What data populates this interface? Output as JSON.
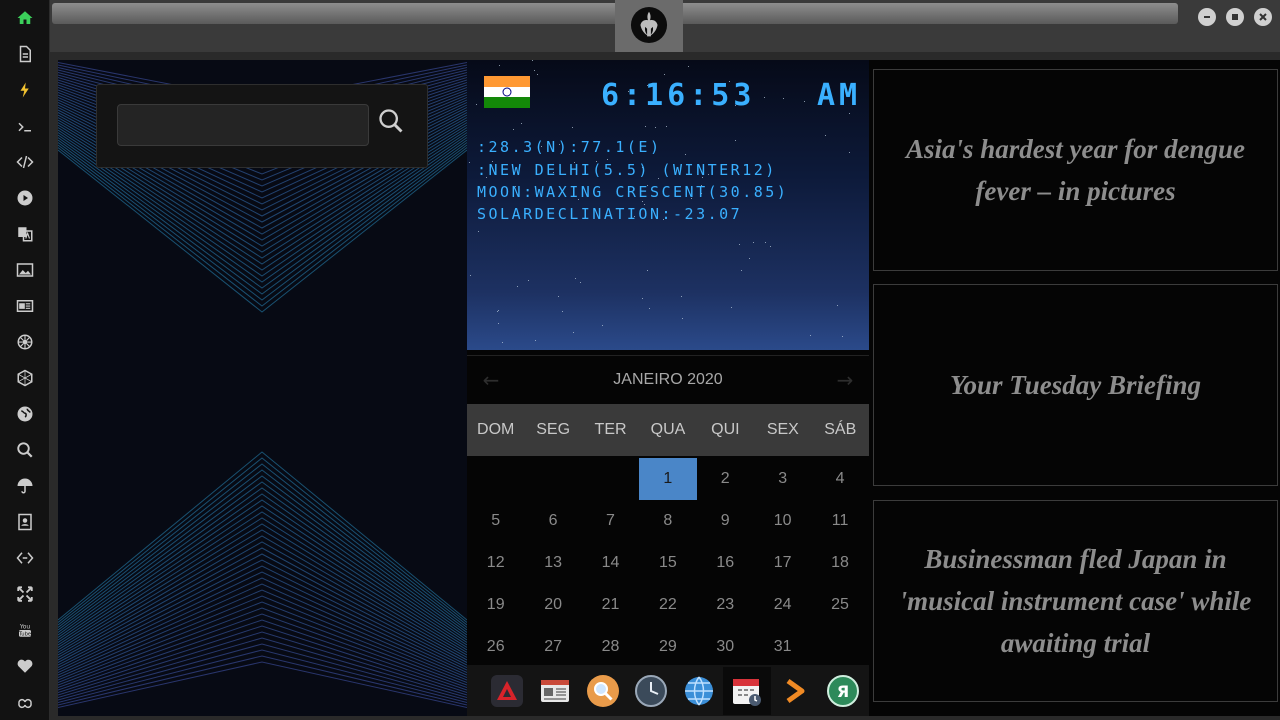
{
  "app": {
    "emblem": "rebel-alliance-emblem"
  },
  "sidebar": {
    "items": [
      {
        "icon": "home-icon",
        "color": "#3bcf5a"
      },
      {
        "icon": "document-icon"
      },
      {
        "icon": "lightning-icon",
        "color": "#f2c230"
      },
      {
        "icon": "terminal-icon"
      },
      {
        "icon": "code-icon"
      },
      {
        "icon": "play-icon"
      },
      {
        "icon": "translate-icon"
      },
      {
        "icon": "image-icon"
      },
      {
        "icon": "news-icon"
      },
      {
        "icon": "empire-emblem-icon"
      },
      {
        "icon": "hexagon-icon"
      },
      {
        "icon": "globe-icon"
      },
      {
        "icon": "search-icon"
      },
      {
        "icon": "umbrella-icon"
      },
      {
        "icon": "contacts-icon"
      },
      {
        "icon": "diamond-link-icon"
      },
      {
        "icon": "expand-icon"
      },
      {
        "icon": "youtube-icon"
      },
      {
        "icon": "heart-icon"
      },
      {
        "icon": "infinity-cloud-icon"
      }
    ]
  },
  "search": {
    "value": "",
    "placeholder": ""
  },
  "clock": {
    "time": "6:16:53",
    "ampm": "AM",
    "lines": [
      ":28.3(N):77.1(E)",
      ":NEW DELHI(5.5) (WINTER12)",
      "MOON:WAXING CRESCENT(30.85)",
      "SOLARDECLINATION:-23.07"
    ],
    "flag": "india-flag"
  },
  "calendar": {
    "month": "JANEIRO 2020",
    "prev": "←",
    "next": "→",
    "weekdays": [
      "DOM",
      "SEG",
      "TER",
      "QUA",
      "QUI",
      "SEX",
      "SÁB"
    ],
    "weeks": [
      [
        "",
        "",
        "",
        "1",
        "2",
        "3",
        "4"
      ],
      [
        "5",
        "6",
        "7",
        "8",
        "9",
        "10",
        "11"
      ],
      [
        "12",
        "13",
        "14",
        "15",
        "16",
        "17",
        "18"
      ],
      [
        "19",
        "20",
        "21",
        "22",
        "23",
        "24",
        "25"
      ],
      [
        "26",
        "27",
        "28",
        "29",
        "30",
        "31",
        ""
      ]
    ],
    "selected": "1",
    "accent": "#4a86c8"
  },
  "dock": {
    "items": [
      {
        "icon": "red-triangle-app-icon"
      },
      {
        "icon": "news-reader-icon"
      },
      {
        "icon": "search-app-icon"
      },
      {
        "icon": "clock-app-icon"
      },
      {
        "icon": "browser-globe-icon"
      },
      {
        "icon": "calendar-app-icon",
        "active": true
      },
      {
        "icon": "chevron-right-app-icon"
      },
      {
        "icon": "yandex-app-icon"
      }
    ]
  },
  "news": [
    {
      "title": "Asia's hardest year for dengue fever – in pictures"
    },
    {
      "title": "Your Tuesday Briefing"
    },
    {
      "title": "Businessman fled Japan in 'musical instrument case' while awaiting trial"
    }
  ]
}
